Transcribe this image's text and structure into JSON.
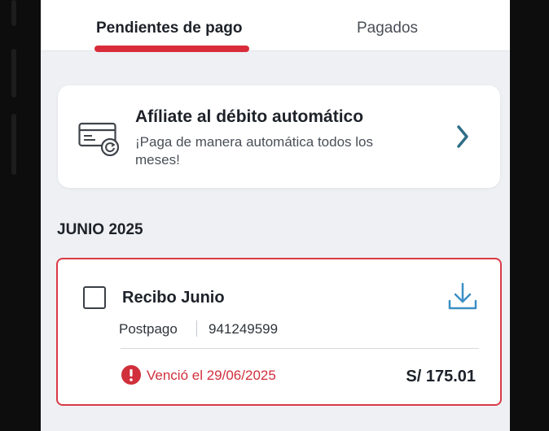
{
  "tabs": {
    "pending_label": "Pendientes de pago",
    "paid_label": "Pagados"
  },
  "promo": {
    "icon": "credit-card-autopay-icon",
    "title": "Afíliate al débito automático",
    "description": "¡Paga de manera automática todos los meses!",
    "chevron_icon": "chevron-right-icon"
  },
  "section": {
    "title": "JUNIO 2025"
  },
  "bill": {
    "title": "Recibo Junio",
    "plan_type": "Postpago",
    "phone_number": "941249599",
    "due_text": "Venció el 29/06/2025",
    "amount": "S/ 175.01",
    "download_icon": "download-icon",
    "alert_icon": "alert-circle-icon"
  },
  "colors": {
    "accent_red": "#d92c3a",
    "chevron_teal": "#2f6f86",
    "download_blue": "#3b8fc4",
    "text_dark": "#1d2229"
  }
}
